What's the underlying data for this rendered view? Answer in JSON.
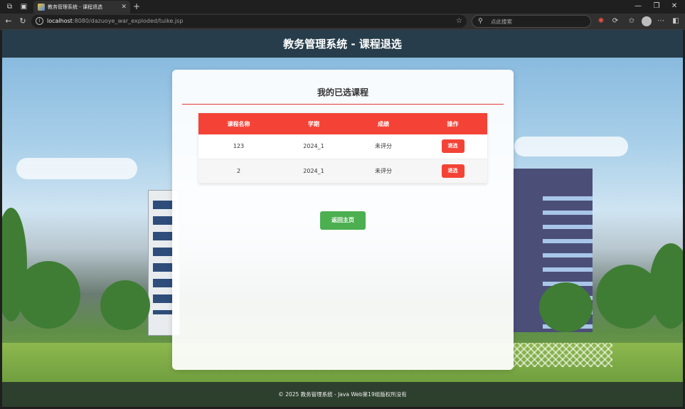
{
  "browser": {
    "tab_title": "教务管理系统 - 课程退选",
    "url_host": "localhost",
    "url_path": ":8080/dazuoye_war_exploded/tuike.jsp",
    "search_placeholder": "点此搜索"
  },
  "header": {
    "title": "教务管理系统 - 课程退选"
  },
  "card": {
    "title": "我的已选课程",
    "columns": [
      "课程名称",
      "学期",
      "成绩",
      "操作"
    ],
    "rows": [
      {
        "course": "123",
        "term": "2024_1",
        "grade": "未评分",
        "action": "退选"
      },
      {
        "course": "2",
        "term": "2024_1",
        "grade": "未评分",
        "action": "退选"
      }
    ],
    "back_label": "返回主页"
  },
  "footer": {
    "text": "© 2025 教务管理系统 - Java Web第19组版权所没有"
  },
  "colors": {
    "accent_red": "#f44336",
    "accent_green": "#4caf50",
    "header_bg": "#20343f"
  }
}
